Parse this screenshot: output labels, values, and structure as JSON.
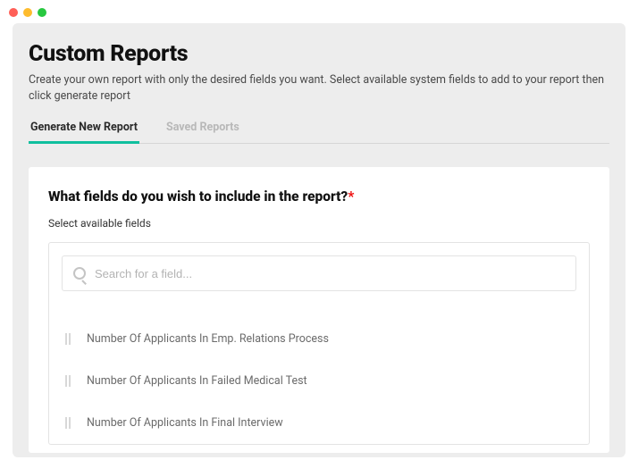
{
  "header": {
    "title": "Custom Reports",
    "subtitle": "Create your own report with only the desired fields you want. Select available system fields to add to your report then click generate report"
  },
  "tabs": [
    {
      "label": "Generate New Report",
      "active": true
    },
    {
      "label": "Saved Reports",
      "active": false
    }
  ],
  "form": {
    "question": "What fields do you wish to include in the report?",
    "required_mark": "*",
    "helper": "Select available fields",
    "search_placeholder": "Search for a field..."
  },
  "fields": [
    {
      "label": "Number Of Applicants In Emp. Relations Process"
    },
    {
      "label": "Number Of Applicants In Failed Medical Test"
    },
    {
      "label": "Number Of Applicants In Final Interview"
    }
  ]
}
